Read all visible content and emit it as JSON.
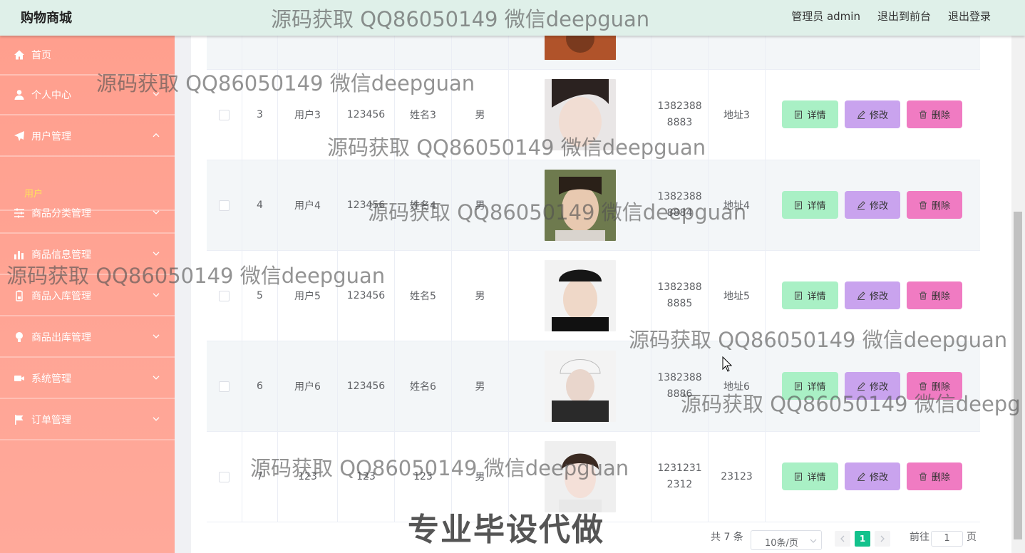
{
  "header": {
    "brand": "购物商城",
    "admin_label": "管理员 admin",
    "to_front": "退出到前台",
    "logout": "退出登录"
  },
  "sidebar": {
    "items": [
      {
        "label": "首页",
        "icon": "home-icon"
      },
      {
        "label": "个人中心",
        "icon": "user-icon"
      },
      {
        "label": "用户管理",
        "icon": "send-icon"
      },
      {
        "label": "商品分类管理",
        "icon": "sliders-icon"
      },
      {
        "label": "商品信息管理",
        "icon": "bar-chart-icon"
      },
      {
        "label": "商品入库管理",
        "icon": "battery-icon"
      },
      {
        "label": "商品出库管理",
        "icon": "bulb-icon"
      },
      {
        "label": "系统管理",
        "icon": "camera-icon"
      },
      {
        "label": "订单管理",
        "icon": "flag-icon"
      }
    ],
    "sub_item": "用户"
  },
  "table": {
    "rows": [
      {
        "index": "3",
        "account": "用户3",
        "password": "123456",
        "name": "姓名3",
        "gender": "男",
        "phone": "1382388\n8883",
        "address": "地址3"
      },
      {
        "index": "4",
        "account": "用户4",
        "password": "123456",
        "name": "姓名4",
        "gender": "男",
        "phone": "1382388\n8884",
        "address": "地址4"
      },
      {
        "index": "5",
        "account": "用户5",
        "password": "123456",
        "name": "姓名5",
        "gender": "男",
        "phone": "1382388\n8885",
        "address": "地址5"
      },
      {
        "index": "6",
        "account": "用户6",
        "password": "123456",
        "name": "姓名6",
        "gender": "男",
        "phone": "1382388\n8886",
        "address": "地址6"
      },
      {
        "index": "7",
        "account": "123",
        "password": "123",
        "name": "123",
        "gender": "男",
        "phone": "1231231\n2312",
        "address": "23123"
      }
    ],
    "actions": {
      "detail": "详情",
      "edit": "修改",
      "delete": "删除"
    }
  },
  "pagination": {
    "total": "共 7 条",
    "page_size": "10条/页",
    "current_page": "1",
    "goto_prefix": "前往",
    "goto_value": "1",
    "goto_suffix": "页"
  },
  "watermark": {
    "text": "源码获取 QQ86050149 微信deepguan",
    "text_cut": "源码获取 QQ86050149 微信deepg",
    "big": "专业毕设代做"
  },
  "colors": {
    "header_bg": "#dff0e9",
    "sidebar_bg": "#ffa494",
    "active_sub": "#ffe35a",
    "detail_btn": "#a9f0c5",
    "edit_btn": "#c9a3ee",
    "delete_btn": "#f07bc2",
    "page_active": "#13c28c"
  }
}
